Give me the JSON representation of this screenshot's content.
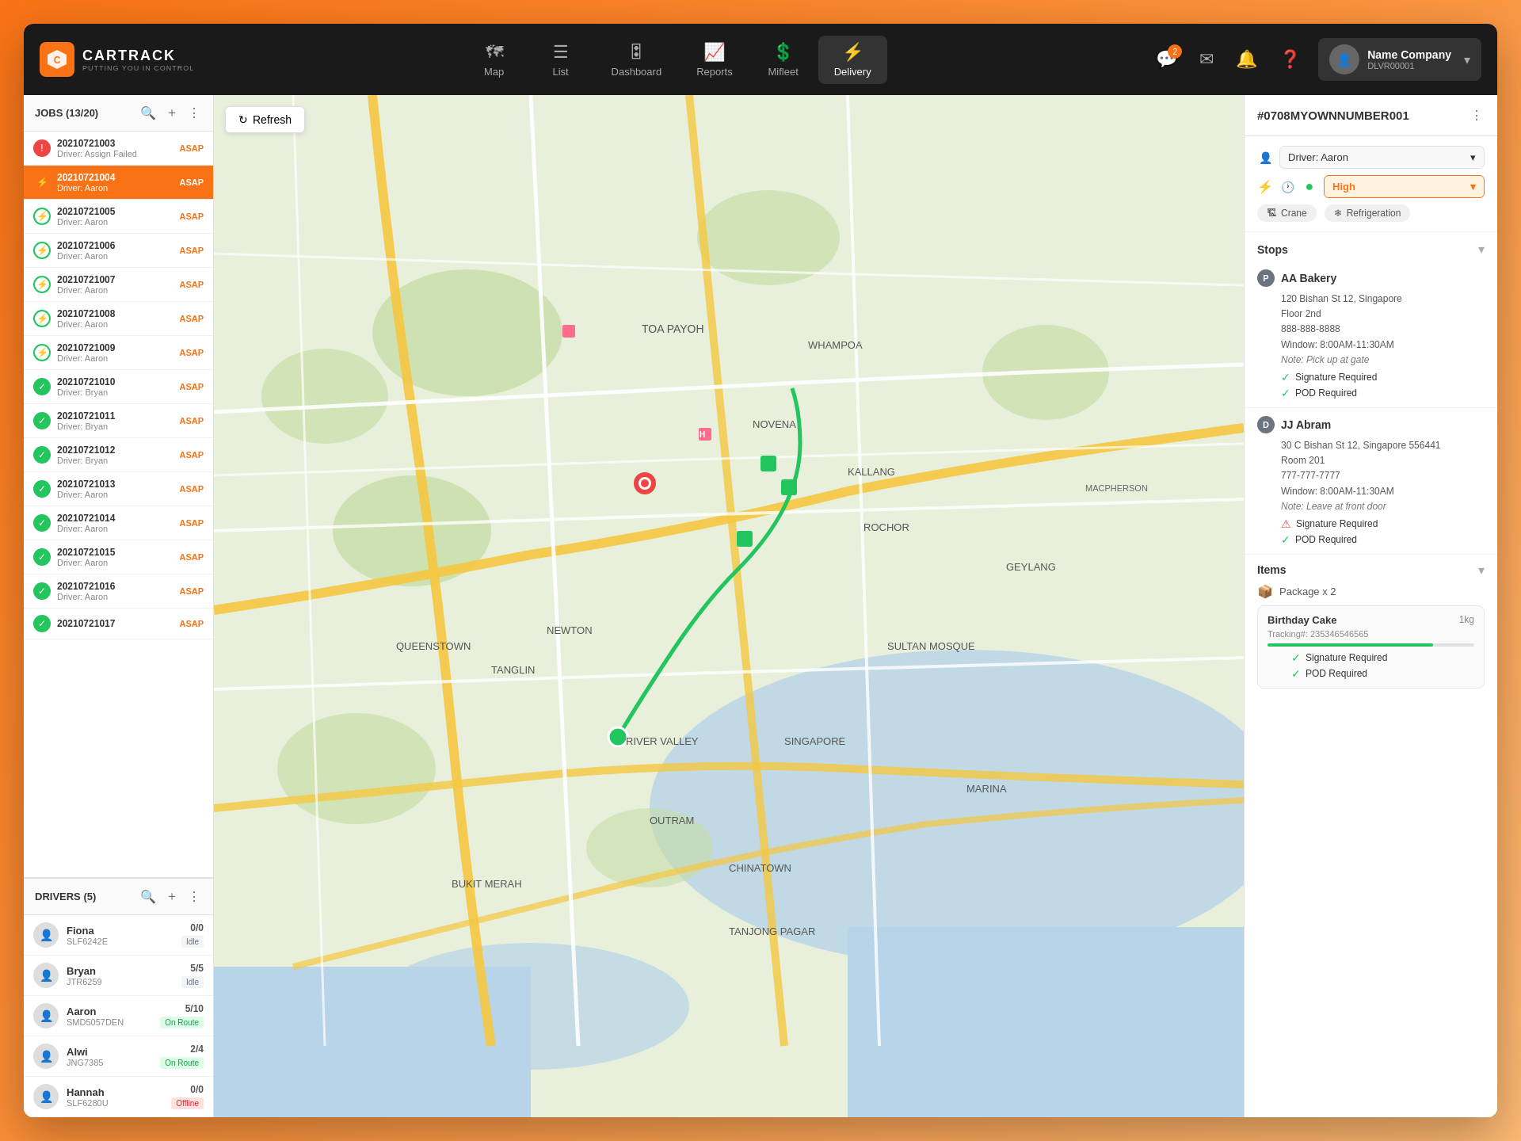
{
  "app": {
    "name": "CARTRACK",
    "subtitle": "PUTTING YOU IN CONTROL",
    "logo_char": "C"
  },
  "nav": {
    "items": [
      {
        "id": "map",
        "label": "Map",
        "icon": "🗺"
      },
      {
        "id": "list",
        "label": "List",
        "icon": "☰"
      },
      {
        "id": "dashboard",
        "label": "Dashboard",
        "icon": "🎛"
      },
      {
        "id": "reports",
        "label": "Reports",
        "icon": "📈"
      },
      {
        "id": "mifleet",
        "label": "Mifleet",
        "icon": "💲"
      },
      {
        "id": "delivery",
        "label": "Delivery",
        "icon": "⚡",
        "active": true
      }
    ]
  },
  "topbar": {
    "notification_badge": "2",
    "user_name": "Name Company",
    "user_id": "DLVR00001"
  },
  "jobs": {
    "title": "JOBS (13/20)",
    "refresh_label": "Refresh",
    "items": [
      {
        "id": "20210721003",
        "driver": "Driver: Assign Failed",
        "tag": "ASAP",
        "status": "failed"
      },
      {
        "id": "20210721004",
        "driver": "Driver: Aaron",
        "tag": "ASAP",
        "status": "asap",
        "selected": true
      },
      {
        "id": "20210721005",
        "driver": "Driver: Aaron",
        "tag": "ASAP",
        "status": "scheduled"
      },
      {
        "id": "20210721006",
        "driver": "Driver: Aaron",
        "tag": "ASAP",
        "status": "scheduled"
      },
      {
        "id": "20210721007",
        "driver": "Driver: Aaron",
        "tag": "ASAP",
        "status": "scheduled"
      },
      {
        "id": "20210721008",
        "driver": "Driver: Aaron",
        "tag": "ASAP",
        "status": "scheduled"
      },
      {
        "id": "20210721009",
        "driver": "Driver: Aaron",
        "tag": "ASAP",
        "status": "scheduled"
      },
      {
        "id": "20210721010",
        "driver": "Driver: Bryan",
        "tag": "ASAP",
        "status": "completed"
      },
      {
        "id": "20210721011",
        "driver": "Driver: Bryan",
        "tag": "ASAP",
        "status": "completed"
      },
      {
        "id": "20210721012",
        "driver": "Driver: Bryan",
        "tag": "ASAP",
        "status": "completed"
      },
      {
        "id": "20210721013",
        "driver": "Driver: Aaron",
        "tag": "ASAP",
        "status": "completed"
      },
      {
        "id": "20210721014",
        "driver": "Driver: Aaron",
        "tag": "ASAP",
        "status": "completed"
      },
      {
        "id": "20210721015",
        "driver": "Driver: Aaron",
        "tag": "ASAP",
        "status": "completed"
      },
      {
        "id": "20210721016",
        "driver": "Driver: Aaron",
        "tag": "ASAP",
        "status": "completed"
      },
      {
        "id": "20210721017",
        "driver": "",
        "tag": "ASAP",
        "status": "completed"
      }
    ]
  },
  "drivers": {
    "title": "DRIVERS (5)",
    "items": [
      {
        "name": "Fiona",
        "plate": "SLF6242E",
        "jobs": "0/0",
        "status": "Idle",
        "status_class": "idle"
      },
      {
        "name": "Bryan",
        "plate": "JTR6259",
        "jobs": "5/5",
        "status": "Idle",
        "status_class": "idle"
      },
      {
        "name": "Aaron",
        "plate": "SMD5057DEN",
        "jobs": "5/10",
        "status": "On Route",
        "status_class": "on-route"
      },
      {
        "name": "Alwi",
        "plate": "JNG7385",
        "jobs": "2/4",
        "status": "On Route",
        "status_class": "on-route"
      },
      {
        "name": "Hannah",
        "plate": "SLF6280U",
        "jobs": "0/0",
        "status": "Offline",
        "status_class": "offline"
      }
    ]
  },
  "detail": {
    "job_id": "#0708MYOWNNUMBER001",
    "driver": "Driver: Aaron",
    "priority": "High",
    "crane_label": "Crane",
    "refrigeration_label": "Refrigeration",
    "stops_title": "Stops",
    "stops": [
      {
        "letter": "P",
        "type": "pickup",
        "name": "AA Bakery",
        "address": "120 Bishan St 12, Singapore",
        "floor": "Floor 2nd",
        "phone": "888-888-8888",
        "window": "Window: 8:00AM-11:30AM",
        "note": "Note: Pick up at gate",
        "sig_required": true,
        "pod_required": true,
        "sig_label": "Signature Required",
        "pod_label": "POD Required"
      },
      {
        "letter": "D",
        "type": "dropoff",
        "name": "JJ Abram",
        "address": "30 C Bishan St 12, Singapore 556441",
        "floor": "Room 201",
        "phone": "777-777-7777",
        "window": "Window: 8:00AM-11:30AM",
        "note": "Note: Leave at front door",
        "sig_required": false,
        "pod_required": true,
        "sig_label": "Signature Required",
        "pod_label": "POD Required"
      }
    ],
    "items_title": "Items",
    "package_label": "Package x 2",
    "item": {
      "name": "Birthday Cake",
      "weight": "1kg",
      "tracking": "Tracking#: 235346546565",
      "sig_required": true,
      "pod_required": true,
      "sig_label": "Signature Required",
      "pod_label": "POD Required",
      "progress": 80
    }
  }
}
